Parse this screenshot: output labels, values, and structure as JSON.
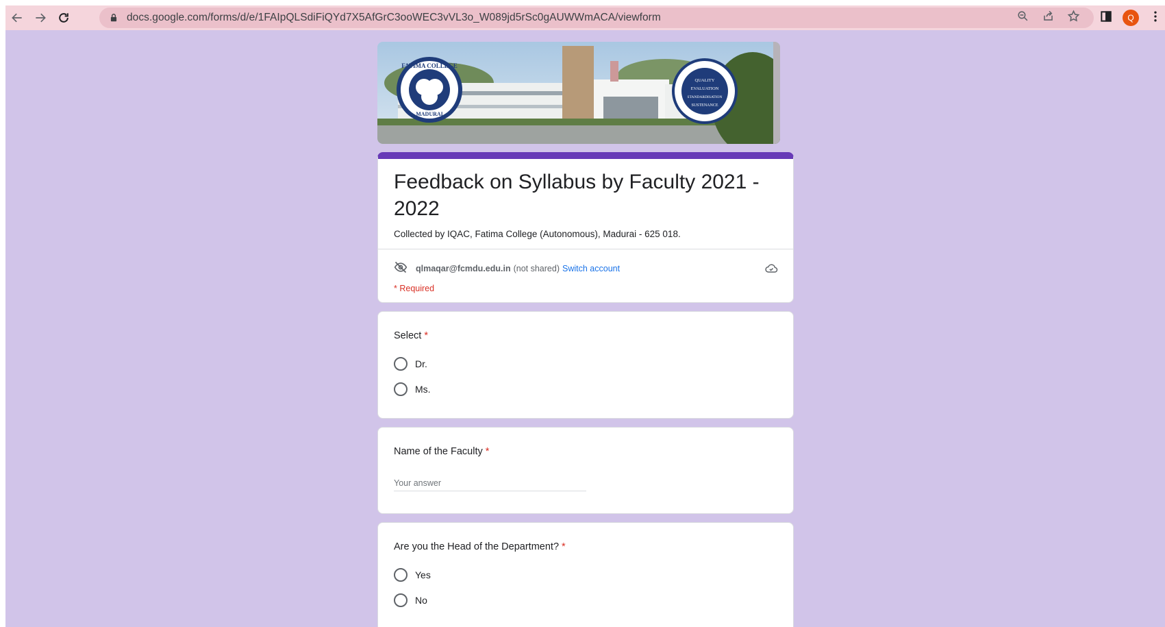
{
  "browser": {
    "url": "docs.google.com/forms/d/e/1FAIpQLSdiFiQYd7X5AfGrC3ooWEC3vVL3o_W089jd5rSc0gAUWWmACA/viewform",
    "profile_initial": "Q",
    "icons": [
      "back-icon",
      "forward-icon",
      "reload-icon",
      "lock-icon",
      "zoom-icon",
      "share-icon",
      "star-icon",
      "side-panel-icon",
      "menu-icon"
    ]
  },
  "form": {
    "title": "Feedback on Syllabus by Faculty 2021 - 2022",
    "description": "Collected by IQAC, Fatima College (Autonomous), Madurai - 625 018.",
    "account": {
      "email": "qlmaqar@fcmdu.edu.in",
      "not_shared": "(not shared)",
      "switch_label": "Switch account"
    },
    "required_note": "* Required",
    "header_image": {
      "left_seal_text": "FATIMA COLLEGE",
      "left_seal_bottom": "MADURAI",
      "right_seal_lines": [
        "QUALITY",
        "EVALUATION",
        "STANDARDISATION",
        "SUSTENANCE"
      ]
    },
    "questions": [
      {
        "label": "Select",
        "required": "*",
        "options": [
          "Dr.",
          "Ms."
        ]
      },
      {
        "label": "Name of the Faculty",
        "required": "*",
        "placeholder": "Your answer"
      },
      {
        "label": "Are you the Head of the Department?",
        "required": "*",
        "options": [
          "Yes",
          "No"
        ]
      }
    ]
  },
  "colors": {
    "page_bg": "#d1c4e9",
    "accent": "#673ab7",
    "required": "#d93025",
    "link": "#1a73e8",
    "chrome_bg": "#f5d5dc"
  }
}
